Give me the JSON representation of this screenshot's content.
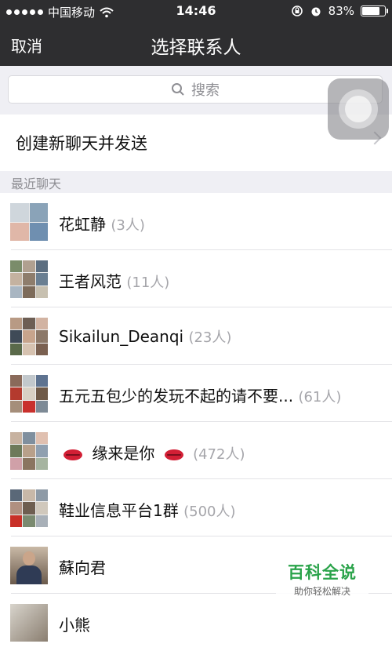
{
  "status_bar": {
    "carrier": "中国移动",
    "time": "14:46",
    "battery": "83%",
    "battery_level": 0.83,
    "icons": [
      "signal-icon",
      "wifi-icon",
      "orientation-lock-icon",
      "alarm-icon",
      "battery-icon"
    ]
  },
  "nav": {
    "cancel": "取消",
    "title": "选择联系人"
  },
  "search": {
    "placeholder": "搜索"
  },
  "new_chat": {
    "label": "创建新聊天并发送"
  },
  "section": {
    "recent": "最近聊天"
  },
  "chats": [
    {
      "name": "花虹静",
      "count": "(3人)"
    },
    {
      "name": "王者风范",
      "count": "(11人)"
    },
    {
      "name": "Sikailun_Deanqi",
      "count": "(23人)"
    },
    {
      "name": "五元五包少的发玩不起的请不要...",
      "count": "(61人)"
    },
    {
      "name": "缘来是你",
      "count": "(472人)"
    },
    {
      "name": "鞋业信息平台1群",
      "count": "(500人)"
    },
    {
      "name": "蘇向君",
      "count": ""
    },
    {
      "name": "小熊",
      "count": ""
    }
  ],
  "watermark": {
    "brand": "百科全说",
    "slogan": "助你轻松解决"
  }
}
